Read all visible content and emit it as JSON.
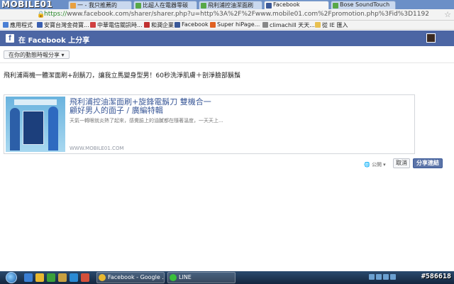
{
  "watermark_logo": "MOBILE01",
  "browser": {
    "tabs": [
      {
        "label": "一 - 我只推薦的",
        "icon_color": "#e8a040",
        "active": false
      },
      {
        "label": "比超人在電器零碳",
        "icon_color": "#58a848",
        "active": false
      },
      {
        "label": "飛利浦控油潔面刷",
        "icon_color": "#58a848",
        "active": false
      },
      {
        "label": "Facebook",
        "icon_color": "#3b5998",
        "active": true
      },
      {
        "label": "Bose SoundTouch",
        "icon_color": "#58a848",
        "active": false
      }
    ],
    "url_scheme": "https://",
    "url_rest": "www.facebook.com/sharer/sharer.php?u=http%3A%2F%2Fwww.mobile01.com%2Fpromotion.php%3Fid%3D1192"
  },
  "bookmarks": [
    {
      "label": "應用程式",
      "icon_color": "#4a7fd4"
    },
    {
      "label": "安寶台灣金荷寶...",
      "icon_color": "#3a5fb0"
    },
    {
      "label": "中華電信關訊時...",
      "icon_color": "#d04040"
    },
    {
      "label": "和潤企業",
      "icon_color": "#c03030"
    },
    {
      "label": "Facebook",
      "icon_color": "#3b5998"
    },
    {
      "label": "Super hiPage...",
      "icon_color": "#e06020"
    },
    {
      "label": "climachill 天天...",
      "icon_color": "#888888"
    },
    {
      "label": "從 IE 匯入",
      "icon_color": "#e8c050"
    }
  ],
  "fb": {
    "header_title": "在 Facebook 上分享",
    "share_where": "在你的動態時報分享 ▾",
    "message": "飛利浦兩機一體潔面刷+刮鬍刀，讓我立馬變身型男！60秒洗淨肌膚＋剖淨臉部鬍鬚",
    "card": {
      "title": "飛利浦控油潔面刷+旋鋒電鬍刀 雙機合一",
      "subtitle": "顧好男人的面子 / 廣編特輯",
      "desc": "天氣一轉眼就炎熱了起來，感覺臉上的油膩都在隨著溫度，一天天上...",
      "domain": "WWW.MOBILE01.COM"
    },
    "privacy": "公開 ▾",
    "cancel": "取消",
    "share": "分享連結"
  },
  "taskbar": {
    "tasks": [
      {
        "label": "Facebook - Google ...",
        "icon_color": "#e8b830"
      },
      {
        "label": "LINE",
        "icon_color": "#3ac03a"
      }
    ],
    "watermark": "#586618"
  }
}
